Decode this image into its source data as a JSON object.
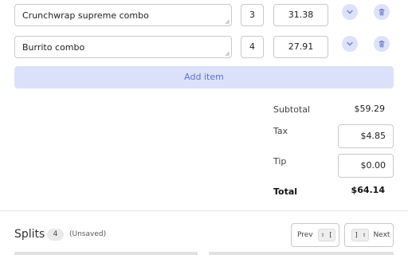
{
  "items": [
    {
      "name": "Crunchwrap supreme combo",
      "qty": "3",
      "price": "31.38"
    },
    {
      "name": "Burrito combo",
      "qty": "4",
      "price": "27.91"
    }
  ],
  "add_item_label": "Add item",
  "summary": {
    "subtotal_label": "Subtotal",
    "subtotal_value": "$59.29",
    "tax_label": "Tax",
    "tax_value": "$4.85",
    "tip_label": "Tip",
    "tip_value": "$0.00",
    "total_label": "Total",
    "total_value": "$64.14"
  },
  "splits": {
    "title": "Splits",
    "count": "4",
    "status": "(Unsaved)",
    "prev_label": "Prev",
    "prev_shortcut": "⇧ [",
    "next_shortcut": "] ⇧",
    "next_label": "Next"
  },
  "colors": {
    "accent": "#5f6fd8",
    "accent_light": "#dbe1fb",
    "icon": "#6b77d6"
  },
  "icons": {
    "expand": "chevron-down-icon",
    "delete": "trash-icon"
  }
}
